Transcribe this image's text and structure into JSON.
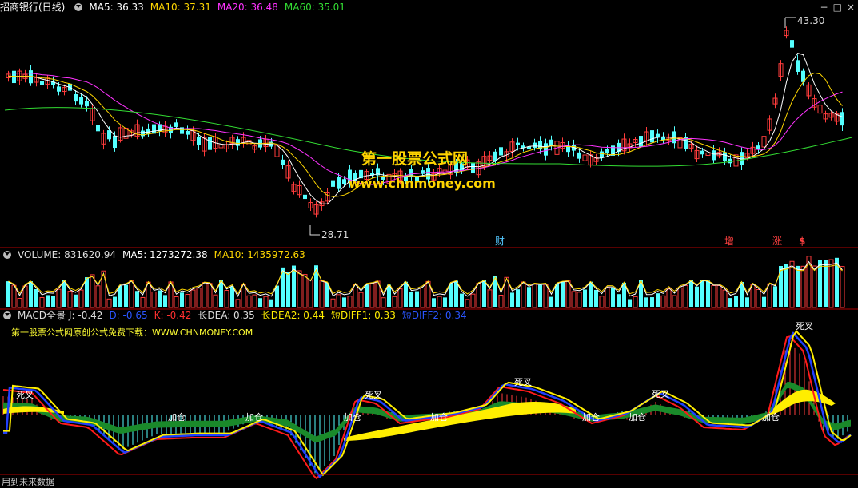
{
  "header": {
    "title": "招商银行(日线)",
    "ma5": "MA5: 36.33",
    "ma10": "MA10: 37.31",
    "ma20": "MA20: 36.48",
    "ma60": "MA60: 35.01",
    "colors": {
      "ma5": "#ffffff",
      "ma10": "#ffd700",
      "ma20": "#ff33ff",
      "ma60": "#33dd33"
    }
  },
  "window_controls": {
    "minimize": "−",
    "restore": "□",
    "close": "×"
  },
  "price_labels": {
    "high": "43.30",
    "low": "28.71"
  },
  "event_markers": {
    "cai": "财",
    "zeng": "增",
    "zhang": "涨",
    "dollar": "$"
  },
  "watermark": {
    "title": "第一股票公式网",
    "url": "www.chnmoney.com"
  },
  "volume_header": {
    "name": "VOLUME: 831620.94",
    "ma5": "MA5: 1273272.38",
    "ma10": "MA10: 1435972.63"
  },
  "macd_header": {
    "name": "MACD全景",
    "j": "J: -0.42",
    "d": "D: -0.65",
    "k": "K: -0.42",
    "dea": "长DEA: 0.35",
    "dea2": "长DEA2: 0.44",
    "diff1": "短DIFF1: 0.33",
    "diff2": "短DIFF2: 0.34"
  },
  "macd_note": "第一股票公式网原创公式免费下载：WWW.CHNMONEY.COM",
  "macd_labels": {
    "death": "死叉",
    "add": "加仓"
  },
  "footer": "用到未来数据",
  "colors": {
    "up": "#ff3c3c",
    "down": "#54ffff",
    "diff_red": "#ff1a1a",
    "diff_blue": "#2040ff",
    "yellow": "#ffee00",
    "green_band": "#1a8a2a"
  }
}
